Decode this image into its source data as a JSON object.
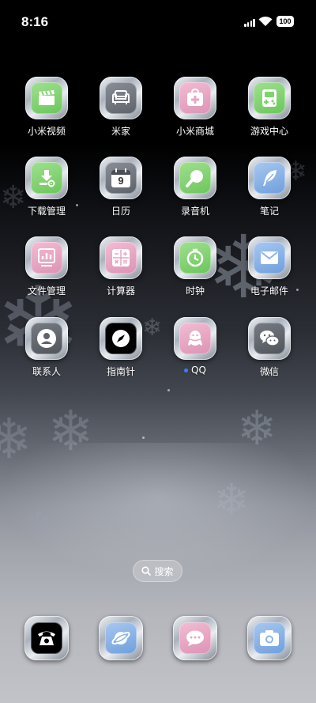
{
  "status_bar": {
    "time": "8:16",
    "battery": "100"
  },
  "home": {
    "apps": [
      {
        "label": "小米视频",
        "icon": "video-clapper-icon",
        "color": "#7fd26f"
      },
      {
        "label": "米家",
        "icon": "sofa-icon",
        "color": "#6f747c"
      },
      {
        "label": "小米商城",
        "icon": "store-cross-icon",
        "color": "#e7a6c4"
      },
      {
        "label": "游戏中心",
        "icon": "gameboy-icon",
        "color": "#7fd26f"
      },
      {
        "label": "下载管理",
        "icon": "download-icon",
        "color": "#7fd26f"
      },
      {
        "label": "日历",
        "icon": "calendar-icon",
        "calendar_day": "9",
        "color": "#6f747c"
      },
      {
        "label": "录音机",
        "icon": "microphone-icon",
        "color": "#7fd26f"
      },
      {
        "label": "笔记",
        "icon": "feather-icon",
        "color": "#8cb5ea"
      },
      {
        "label": "文件管理",
        "icon": "file-chart-icon",
        "color": "#e7a6c4"
      },
      {
        "label": "计算器",
        "icon": "calculator-icon",
        "color": "#e7a6c4"
      },
      {
        "label": "时钟",
        "icon": "clock-icon",
        "color": "#7fd26f"
      },
      {
        "label": "电子邮件",
        "icon": "envelope-icon",
        "color": "#8cb5ea"
      },
      {
        "label": "联系人",
        "icon": "contact-person-icon",
        "color": "#6f747c"
      },
      {
        "label": "指南针",
        "icon": "compass-icon",
        "color": "#000000"
      },
      {
        "label": "QQ",
        "icon": "qq-penguin-icon",
        "color": "#e7a6c4",
        "badge_color": "#3d7cf5"
      },
      {
        "label": "微信",
        "icon": "wechat-icon",
        "color": "#6f747c"
      }
    ]
  },
  "search": {
    "label": "搜索"
  },
  "dock": {
    "apps": [
      {
        "icon": "phone-icon",
        "color": "#000000"
      },
      {
        "icon": "browser-planet-icon",
        "color": "#8cb5ea"
      },
      {
        "icon": "message-bubble-icon",
        "color": "#e7a6c4"
      },
      {
        "icon": "camera-icon",
        "color": "#8cb5ea"
      }
    ]
  }
}
